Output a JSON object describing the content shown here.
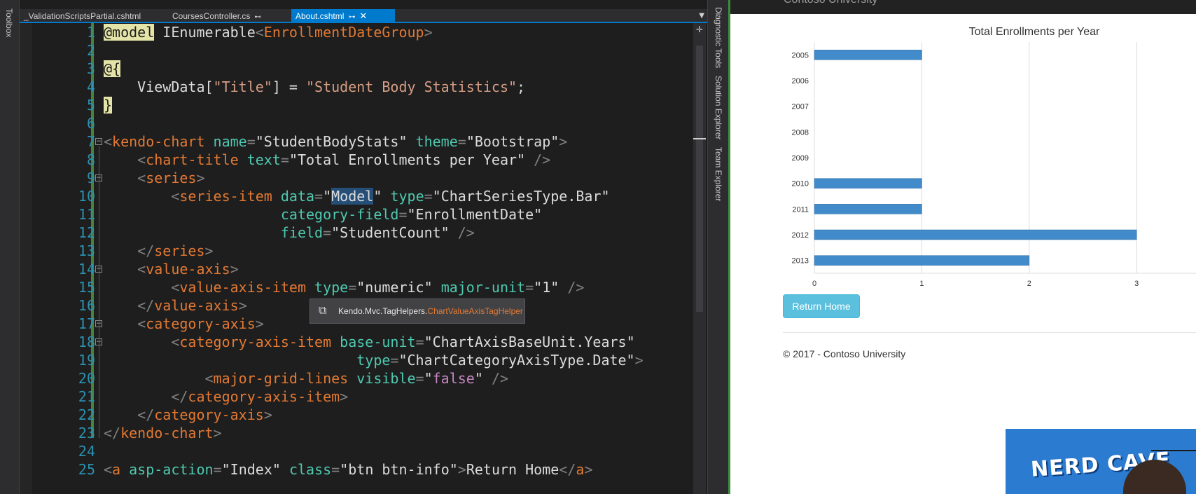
{
  "vs": {
    "left_panel": "Toolbox",
    "right_panels": [
      "Diagnostic Tools",
      "Solution Explorer",
      "Team Explorer"
    ],
    "tabs": [
      {
        "label": "_ValidationScriptsPartial.cshtml",
        "active": false,
        "pinned": false
      },
      {
        "label": "CoursesController.cs",
        "active": false,
        "pinned": true
      },
      {
        "label": "About.cshtml",
        "active": true,
        "pinned": true
      }
    ],
    "tooltip": {
      "namespace": "Kendo.Mvc.TagHelpers.",
      "class_name": "ChartValueAxisTagHelper"
    },
    "code_lines": [
      {
        "n": "1",
        "tokens": [
          [
            "razor",
            "@model"
          ],
          [
            "type",
            " IEnumerable"
          ],
          [
            "punct",
            "<"
          ],
          [
            "tag",
            "EnrollmentDateGroup"
          ],
          [
            "punct",
            ">"
          ]
        ]
      },
      {
        "n": "2",
        "tokens": []
      },
      {
        "n": "3",
        "tokens": [
          [
            "razor",
            "@{"
          ]
        ]
      },
      {
        "n": "4",
        "tokens": [
          [
            "plain",
            "    ViewData["
          ],
          [
            "str",
            "\"Title\""
          ],
          [
            "plain",
            "] = "
          ],
          [
            "str",
            "\"Student Body Statistics\""
          ],
          [
            "plain",
            ";"
          ]
        ]
      },
      {
        "n": "5",
        "tokens": [
          [
            "razor",
            "}"
          ]
        ]
      },
      {
        "n": "6",
        "tokens": []
      },
      {
        "n": "7",
        "tokens": [
          [
            "punct",
            "<"
          ],
          [
            "tag",
            "kendo-chart"
          ],
          [
            "plain",
            " "
          ],
          [
            "attr",
            "name"
          ],
          [
            "punct",
            "="
          ],
          [
            "val",
            "\"StudentBodyStats\""
          ],
          [
            "plain",
            " "
          ],
          [
            "attr",
            "theme"
          ],
          [
            "punct",
            "="
          ],
          [
            "val",
            "\"Bootstrap\""
          ],
          [
            "punct",
            ">"
          ]
        ]
      },
      {
        "n": "8",
        "tokens": [
          [
            "plain",
            "    "
          ],
          [
            "punct",
            "<"
          ],
          [
            "tag",
            "chart-title"
          ],
          [
            "plain",
            " "
          ],
          [
            "attr",
            "text"
          ],
          [
            "punct",
            "="
          ],
          [
            "val",
            "\"Total Enrollments per Year\""
          ],
          [
            "plain",
            " "
          ],
          [
            "punct",
            "/>"
          ]
        ]
      },
      {
        "n": "9",
        "tokens": [
          [
            "plain",
            "    "
          ],
          [
            "punct",
            "<"
          ],
          [
            "tag",
            "series"
          ],
          [
            "punct",
            ">"
          ]
        ]
      },
      {
        "n": "10",
        "tokens": [
          [
            "plain",
            "        "
          ],
          [
            "punct",
            "<"
          ],
          [
            "tag",
            "series-item"
          ],
          [
            "plain",
            " "
          ],
          [
            "attr",
            "data"
          ],
          [
            "punct",
            "="
          ],
          [
            "val",
            "\""
          ],
          [
            "hl",
            "Model"
          ],
          [
            "val",
            "\""
          ],
          [
            "plain",
            " "
          ],
          [
            "attr",
            "type"
          ],
          [
            "punct",
            "="
          ],
          [
            "val",
            "\"ChartSeriesType.Bar\""
          ]
        ]
      },
      {
        "n": "11",
        "tokens": [
          [
            "plain",
            "                     "
          ],
          [
            "attr",
            "category-field"
          ],
          [
            "punct",
            "="
          ],
          [
            "val",
            "\"EnrollmentDate\""
          ]
        ]
      },
      {
        "n": "12",
        "tokens": [
          [
            "plain",
            "                     "
          ],
          [
            "attr",
            "field"
          ],
          [
            "punct",
            "="
          ],
          [
            "val",
            "\"StudentCount\""
          ],
          [
            "plain",
            " "
          ],
          [
            "punct",
            "/>"
          ]
        ]
      },
      {
        "n": "13",
        "tokens": [
          [
            "plain",
            "    "
          ],
          [
            "punct",
            "</"
          ],
          [
            "tag",
            "series"
          ],
          [
            "punct",
            ">"
          ]
        ]
      },
      {
        "n": "14",
        "tokens": [
          [
            "plain",
            "    "
          ],
          [
            "punct",
            "<"
          ],
          [
            "tag",
            "value-axis"
          ],
          [
            "punct",
            ">"
          ]
        ]
      },
      {
        "n": "15",
        "tokens": [
          [
            "plain",
            "        "
          ],
          [
            "punct",
            "<"
          ],
          [
            "tag",
            "value-axis-item"
          ],
          [
            "plain",
            " "
          ],
          [
            "attr",
            "type"
          ],
          [
            "punct",
            "="
          ],
          [
            "val",
            "\"numeric\""
          ],
          [
            "plain",
            " "
          ],
          [
            "attr",
            "major-unit"
          ],
          [
            "punct",
            "="
          ],
          [
            "val",
            "\"1\""
          ],
          [
            "plain",
            " "
          ],
          [
            "punct",
            "/>"
          ]
        ]
      },
      {
        "n": "16",
        "tokens": [
          [
            "plain",
            "    "
          ],
          [
            "punct",
            "</"
          ],
          [
            "tag",
            "value-axis"
          ],
          [
            "punct",
            ">"
          ]
        ]
      },
      {
        "n": "17",
        "tokens": [
          [
            "plain",
            "    "
          ],
          [
            "punct",
            "<"
          ],
          [
            "tag",
            "category-axis"
          ],
          [
            "punct",
            ">"
          ]
        ]
      },
      {
        "n": "18",
        "tokens": [
          [
            "plain",
            "        "
          ],
          [
            "punct",
            "<"
          ],
          [
            "tag",
            "category-axis-item"
          ],
          [
            "plain",
            " "
          ],
          [
            "attr",
            "base-unit"
          ],
          [
            "punct",
            "="
          ],
          [
            "val",
            "\"ChartAxisBaseUnit.Years\""
          ]
        ]
      },
      {
        "n": "19",
        "tokens": [
          [
            "plain",
            "                              "
          ],
          [
            "attr",
            "type"
          ],
          [
            "punct",
            "="
          ],
          [
            "val",
            "\"ChartCategoryAxisType.Date\""
          ],
          [
            "punct",
            ">"
          ]
        ]
      },
      {
        "n": "20",
        "tokens": [
          [
            "plain",
            "            "
          ],
          [
            "punct",
            "<"
          ],
          [
            "tag",
            "major-grid-lines"
          ],
          [
            "plain",
            " "
          ],
          [
            "attr",
            "visible"
          ],
          [
            "punct",
            "="
          ],
          [
            "val",
            "\""
          ],
          [
            "false",
            "false"
          ],
          [
            "val",
            "\""
          ],
          [
            "plain",
            " "
          ],
          [
            "punct",
            "/>"
          ]
        ]
      },
      {
        "n": "21",
        "tokens": [
          [
            "plain",
            "        "
          ],
          [
            "punct",
            "</"
          ],
          [
            "tag",
            "category-axis-item"
          ],
          [
            "punct",
            ">"
          ]
        ]
      },
      {
        "n": "22",
        "tokens": [
          [
            "plain",
            "    "
          ],
          [
            "punct",
            "</"
          ],
          [
            "tag",
            "category-axis"
          ],
          [
            "punct",
            ">"
          ]
        ]
      },
      {
        "n": "23",
        "tokens": [
          [
            "punct",
            "</"
          ],
          [
            "tag",
            "kendo-chart"
          ],
          [
            "punct",
            ">"
          ]
        ]
      },
      {
        "n": "24",
        "tokens": []
      },
      {
        "n": "25",
        "tokens": [
          [
            "punct",
            "<"
          ],
          [
            "tag",
            "a"
          ],
          [
            "plain",
            " "
          ],
          [
            "attr",
            "asp-action"
          ],
          [
            "punct",
            "="
          ],
          [
            "val",
            "\"Index\""
          ],
          [
            "plain",
            " "
          ],
          [
            "attr",
            "class"
          ],
          [
            "punct",
            "="
          ],
          [
            "val",
            "\"btn btn-info\""
          ],
          [
            "punct",
            ">"
          ],
          [
            "plain",
            "Return Home"
          ],
          [
            "punct",
            "</"
          ],
          [
            "tag",
            "a"
          ],
          [
            "punct",
            ">"
          ]
        ]
      }
    ]
  },
  "browser": {
    "brand": "Contoso University",
    "return_button": "Return Home",
    "footer": "© 2017 - Contoso University",
    "webcam_logo": "NERD CAVE"
  },
  "chart_data": {
    "type": "bar",
    "title": "Total Enrollments per Year",
    "xlabel": "",
    "ylabel": "",
    "categories": [
      "2005",
      "2006",
      "2007",
      "2008",
      "2009",
      "2010",
      "2011",
      "2012",
      "2013"
    ],
    "values": [
      1,
      0,
      0,
      0,
      0,
      1,
      1,
      3,
      2
    ],
    "value_axis": {
      "min": 0,
      "max": 3,
      "major_unit": 1,
      "ticks": [
        "0",
        "1",
        "2",
        "3"
      ]
    },
    "grid": true,
    "bar_color": "#428bca",
    "orientation": "horizontal"
  }
}
